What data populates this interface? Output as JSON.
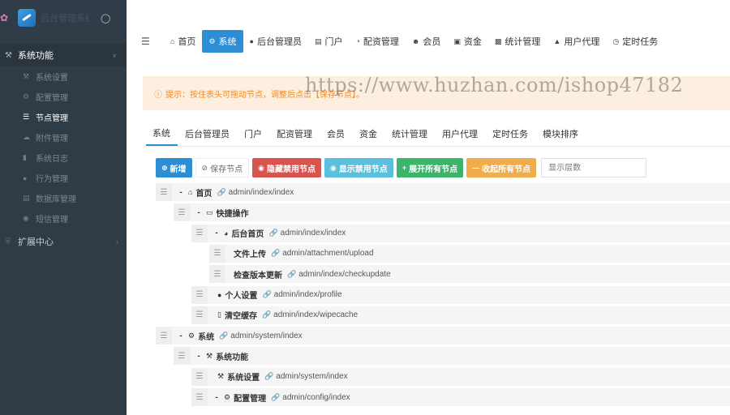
{
  "sidebar": {
    "logo_text": "后台管理系统",
    "group_system": "系统功能",
    "items": [
      {
        "label": "系统设置",
        "icon": "wrench-icon"
      },
      {
        "label": "配置管理",
        "icon": "gears-icon"
      },
      {
        "label": "节点管理",
        "icon": "list-icon",
        "active": true
      },
      {
        "label": "附件管理",
        "icon": "cloud-icon"
      },
      {
        "label": "系统日志",
        "icon": "book-icon"
      },
      {
        "label": "行为管理",
        "icon": "user-icon"
      },
      {
        "label": "数据库管理",
        "icon": "database-icon"
      },
      {
        "label": "短信管理",
        "icon": "comment-icon"
      }
    ],
    "group_extend": "扩展中心"
  },
  "topnav": {
    "items": [
      {
        "label": "首页",
        "icon": "home-icon"
      },
      {
        "label": "系统",
        "icon": "gear-icon",
        "active": true
      },
      {
        "label": "后台管理员",
        "icon": "user-icon"
      },
      {
        "label": "门户",
        "icon": "newspaper-icon"
      },
      {
        "label": "配资管理",
        "icon": "pie-chart-icon"
      },
      {
        "label": "会员",
        "icon": "users-icon"
      },
      {
        "label": "资金",
        "icon": "money-icon"
      },
      {
        "label": "统计管理",
        "icon": "bar-chart-icon"
      },
      {
        "label": "用户代理",
        "icon": "sitemap-icon"
      },
      {
        "label": "定时任务",
        "icon": "clock-icon"
      }
    ]
  },
  "alert": {
    "text": "提示：按住表头可拖动节点，调整后点击【保存节点】。"
  },
  "watermark": "https://www.huzhan.com/ishop47182",
  "tabs": [
    "系统",
    "后台管理员",
    "门户",
    "配资管理",
    "会员",
    "资金",
    "统计管理",
    "用户代理",
    "定时任务",
    "模块排序"
  ],
  "toolbar": {
    "add": "新增",
    "save": "保存节点",
    "hide_disabled": "隐藏禁用节点",
    "show_disabled": "显示禁用节点",
    "expand_all": "展开所有节点",
    "collapse_all": "收起所有节点",
    "layer_placeholder": "显示层数"
  },
  "tree": [
    {
      "title": "首页",
      "url": "admin/index/index",
      "icon": "home-icon",
      "level": 0,
      "toggle": "-"
    },
    {
      "title": "快捷操作",
      "url": "",
      "icon": "folder-open-icon",
      "level": 1,
      "toggle": "-"
    },
    {
      "title": "后台首页",
      "url": "admin/index/index",
      "icon": "dashboard-icon",
      "level": 2,
      "toggle": "-"
    },
    {
      "title": "文件上传",
      "url": "admin/attachment/upload",
      "icon": "",
      "level": 3,
      "toggle": ""
    },
    {
      "title": "检查版本更新",
      "url": "admin/index/checkupdate",
      "icon": "",
      "level": 3,
      "toggle": ""
    },
    {
      "title": "个人设置",
      "url": "admin/index/profile",
      "icon": "user-icon",
      "level": 2,
      "toggle": ""
    },
    {
      "title": "清空缓存",
      "url": "admin/index/wipecache",
      "icon": "trash-icon",
      "level": 2,
      "toggle": ""
    },
    {
      "title": "系统",
      "url": "admin/system/index",
      "icon": "gear-icon",
      "level": 0,
      "toggle": "-"
    },
    {
      "title": "系统功能",
      "url": "",
      "icon": "wrench-icon",
      "level": 1,
      "toggle": "-"
    },
    {
      "title": "系统设置",
      "url": "admin/system/index",
      "icon": "wrench-icon",
      "level": 2,
      "toggle": ""
    },
    {
      "title": "配置管理",
      "url": "admin/config/index",
      "icon": "gears-icon",
      "level": 2,
      "toggle": "-"
    }
  ]
}
